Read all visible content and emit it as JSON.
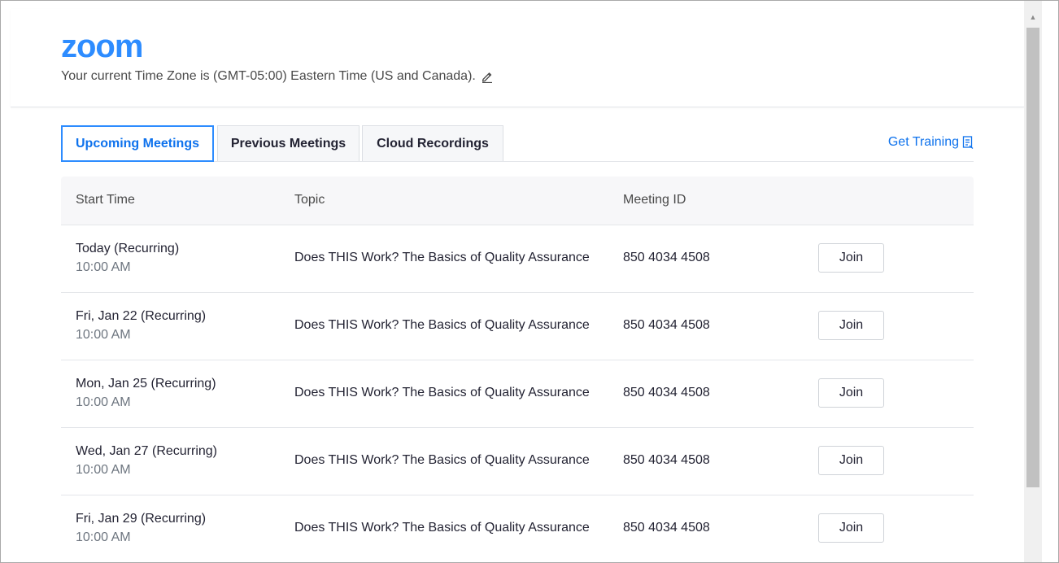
{
  "header": {
    "logo_text": "zoom",
    "timezone_text": "Your current Time Zone is (GMT-05:00) Eastern Time (US and Canada).",
    "edit_icon": "pencil-icon"
  },
  "tabs": [
    {
      "label": "Upcoming Meetings",
      "active": true
    },
    {
      "label": "Previous Meetings",
      "active": false
    },
    {
      "label": "Cloud Recordings",
      "active": false
    }
  ],
  "get_training": {
    "label": "Get Training",
    "icon": "document-icon"
  },
  "table": {
    "columns": [
      "Start Time",
      "Topic",
      "Meeting ID"
    ],
    "rows": [
      {
        "date": "Today (Recurring)",
        "time": "10:00 AM",
        "topic": "Does THIS Work? The Basics of Quality Assurance",
        "meeting_id": "850 4034 4508",
        "action": "Join"
      },
      {
        "date": "Fri, Jan 22 (Recurring)",
        "time": "10:00 AM",
        "topic": "Does THIS Work? The Basics of Quality Assurance",
        "meeting_id": "850 4034 4508",
        "action": "Join"
      },
      {
        "date": "Mon, Jan 25 (Recurring)",
        "time": "10:00 AM",
        "topic": "Does THIS Work? The Basics of Quality Assurance",
        "meeting_id": "850 4034 4508",
        "action": "Join"
      },
      {
        "date": "Wed, Jan 27 (Recurring)",
        "time": "10:00 AM",
        "topic": "Does THIS Work? The Basics of Quality Assurance",
        "meeting_id": "850 4034 4508",
        "action": "Join"
      },
      {
        "date": "Fri, Jan 29 (Recurring)",
        "time": "10:00 AM",
        "topic": "Does THIS Work? The Basics of Quality Assurance",
        "meeting_id": "850 4034 4508",
        "action": "Join"
      }
    ]
  },
  "colors": {
    "brand": "#2d8cff",
    "link": "#0e72ed",
    "text": "#232333",
    "muted": "#6e7680"
  }
}
